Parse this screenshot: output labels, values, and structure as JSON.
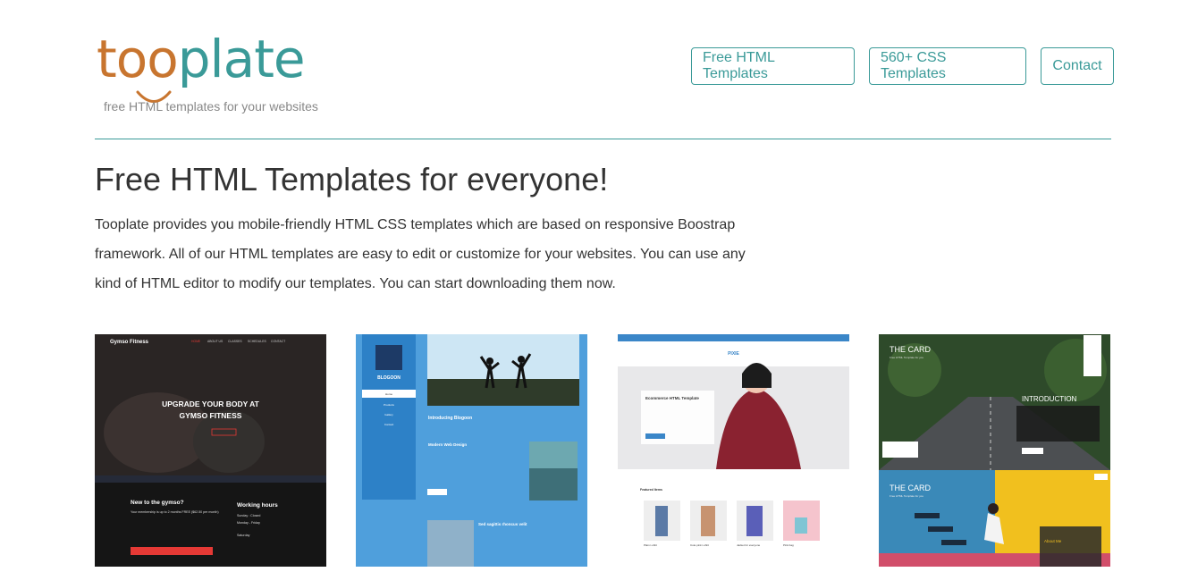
{
  "header": {
    "logo_part1": "too",
    "logo_part2": "plate",
    "tagline": "free HTML templates for your websites",
    "brand_colors": {
      "orange": "#c8752f",
      "teal": "#3a9a98"
    }
  },
  "nav": [
    {
      "label": "Free HTML Templates"
    },
    {
      "label": "560+ CSS Templates"
    },
    {
      "label": "Contact"
    }
  ],
  "hero": {
    "title": "Free HTML Templates for everyone!",
    "text": "Tooplate provides you mobile-friendly HTML CSS templates which are based on responsive Boostrap framework. All of our HTML templates are easy to edit or customize for your websites. You can use any kind of HTML editor to modify our templates. You can start downloading them now."
  },
  "templates": [
    {
      "brand": "Gymso Fitness",
      "nav": [
        "HOME",
        "ABOUT US",
        "CLASSES",
        "SCHEDULES",
        "CONTACT"
      ],
      "headline_1": "UPGRADE YOUR BODY AT",
      "headline_2": "GYMSO FITNESS",
      "promo_title": "New to the gymso?",
      "promo_text": "Your membership is up to 2 months FREE ($62.50 per month)",
      "hours_title": "Working hours",
      "hours_1": "Sunday : Closed",
      "hours_2": "Monday - Friday",
      "hours_3": "Saturday"
    },
    {
      "brand": "BLOGOON",
      "post_1_title": "Introducing Blogoon",
      "post_2_title": "Modern Web Design",
      "post_3_title": "Sed sagittis rhoncus velit",
      "menu": [
        "Home",
        "Products",
        "Gallery",
        "Contact"
      ]
    },
    {
      "brand": "PIXIE",
      "banner_title": "Ecommerce HTML Template",
      "section_title": "Featured Items",
      "products": [
        "Plain t-shirt",
        "Cute pink t-shirt",
        "Jacket for everyone",
        "Pink bag"
      ]
    },
    {
      "title_1": "THE CARD",
      "subtitle_1": "Free HTML Template for you",
      "intro_heading": "INTRODUCTION",
      "title_2": "THE CARD",
      "subtitle_2": "Free HTML Template for you",
      "about_heading": "About Me"
    }
  ]
}
